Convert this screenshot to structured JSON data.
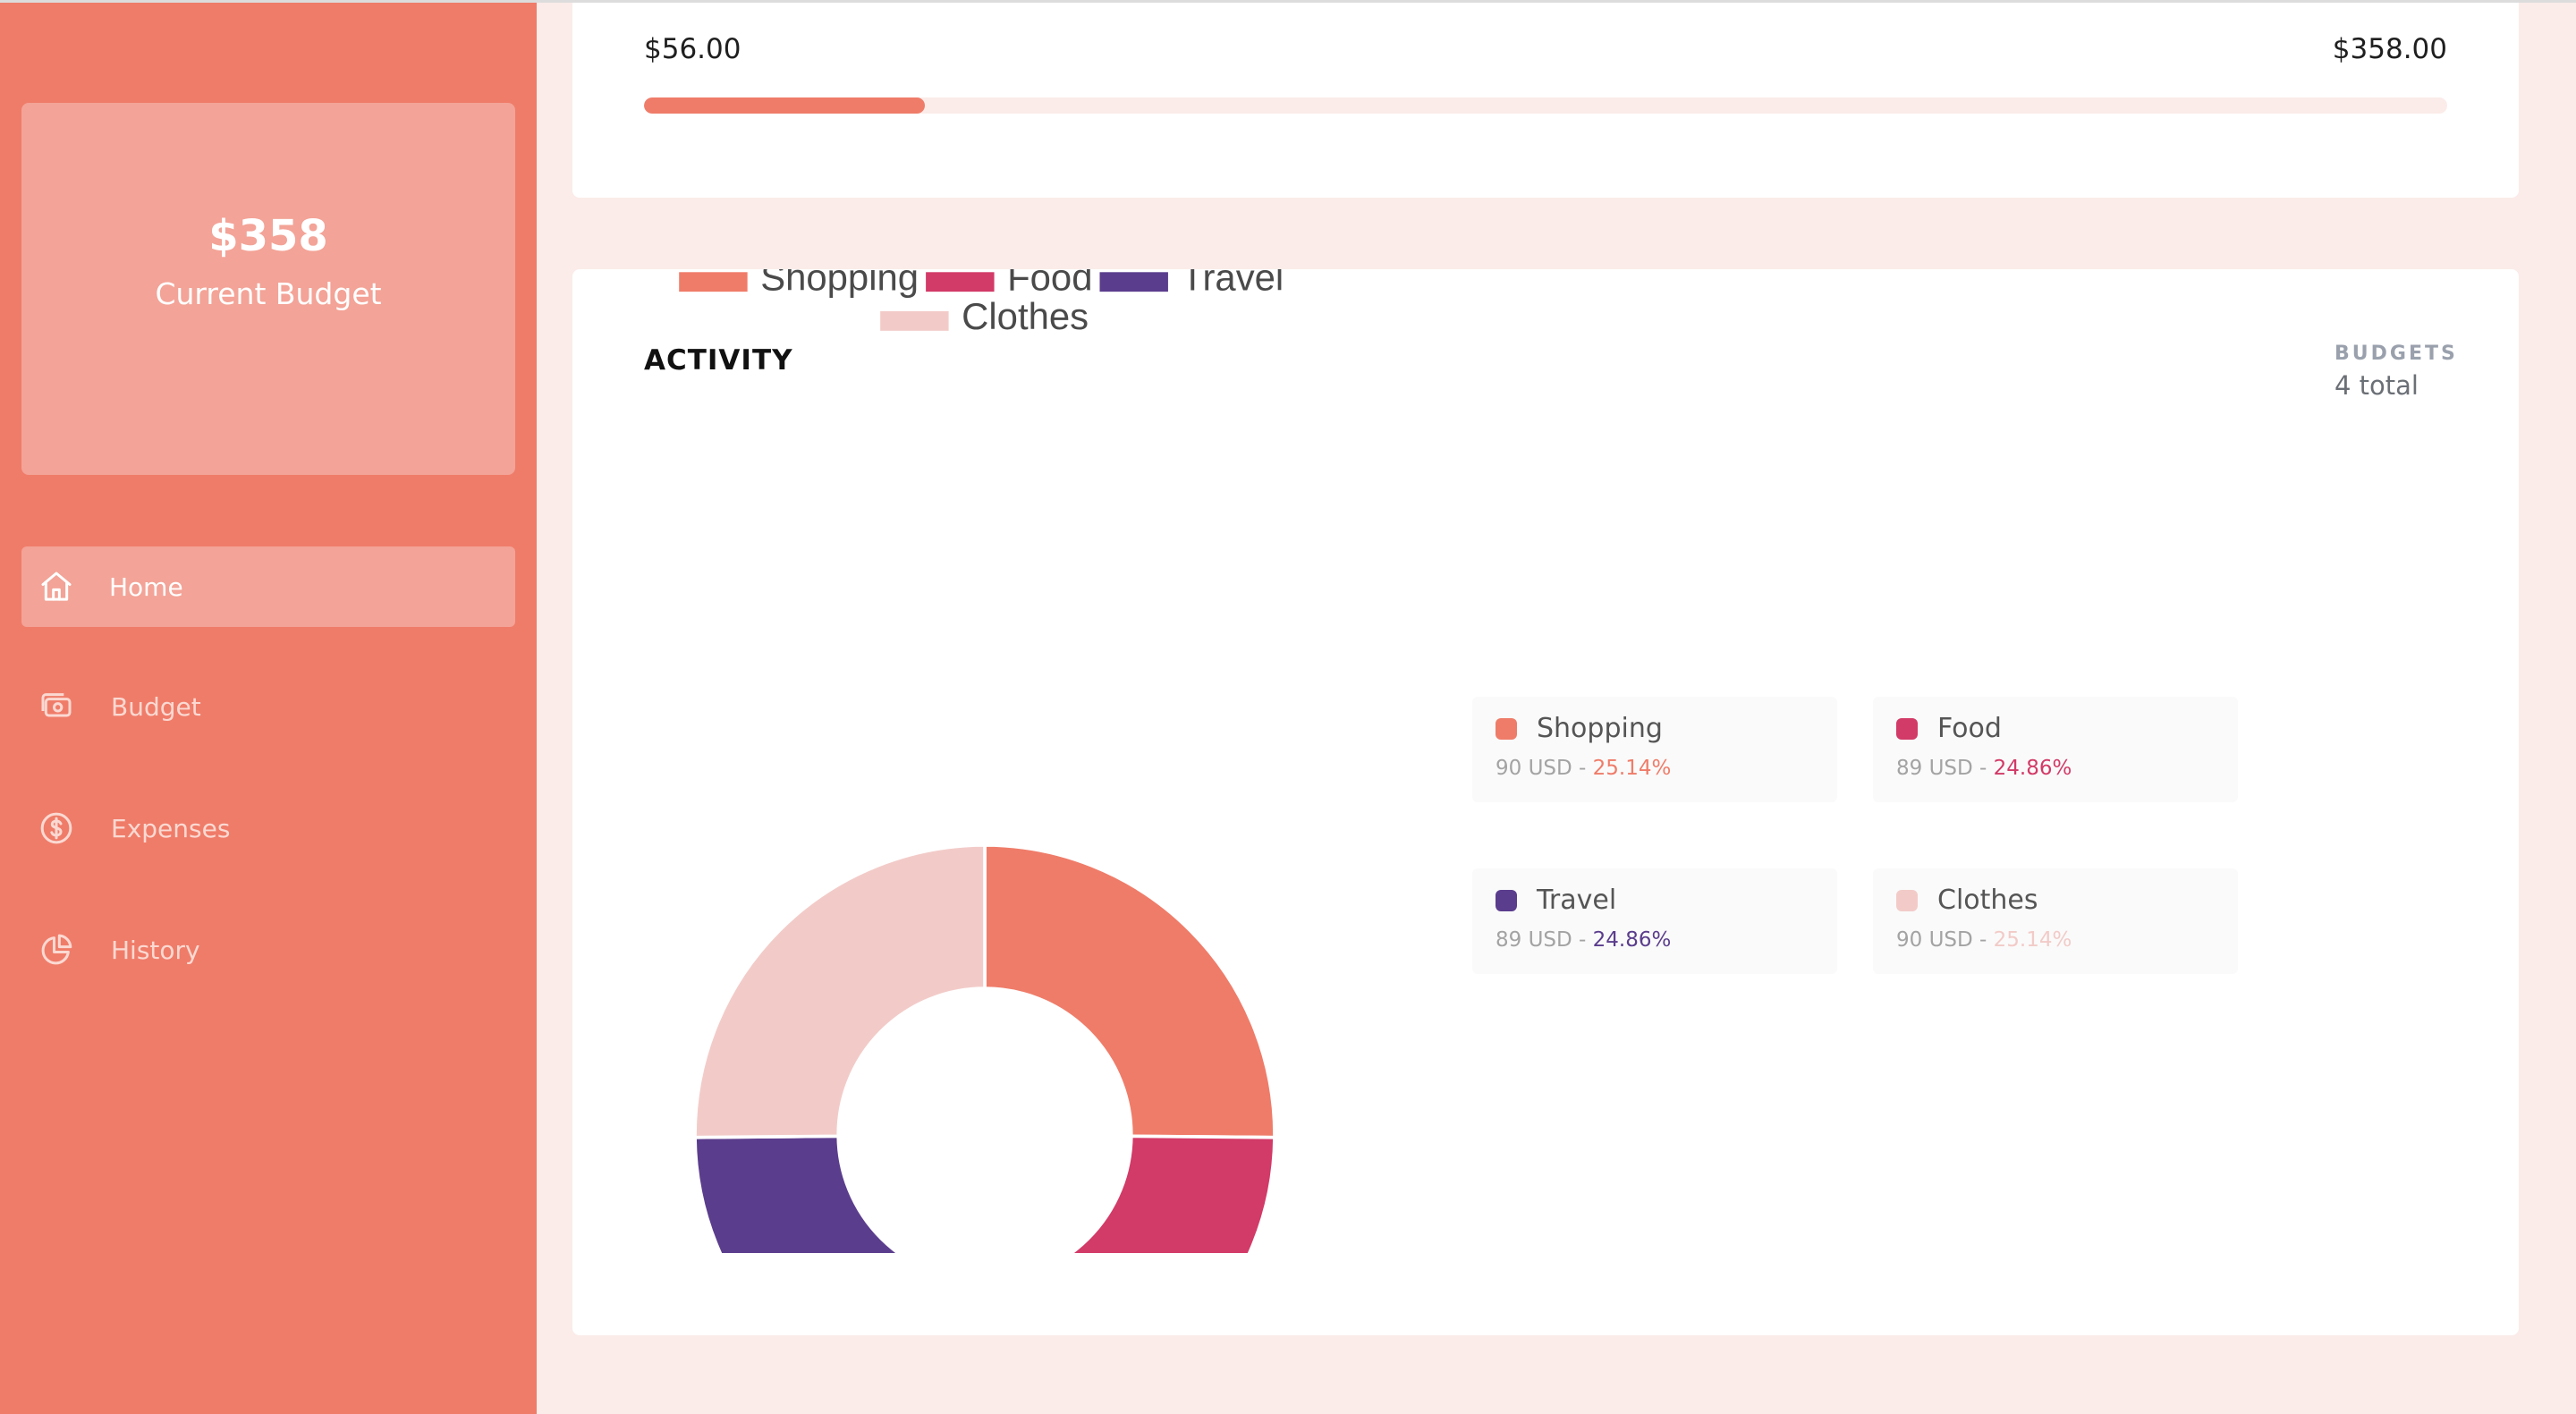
{
  "sidebar": {
    "budget_amount": "$358",
    "budget_label": "Current Budget",
    "items": [
      {
        "label": "Home",
        "icon": "home-icon",
        "active": true
      },
      {
        "label": "Budget",
        "icon": "money-icon",
        "active": false
      },
      {
        "label": "Expenses",
        "icon": "dollar-circle-icon",
        "active": false
      },
      {
        "label": "History",
        "icon": "pie-chart-icon",
        "active": false
      }
    ]
  },
  "summary": {
    "spent": "$56.00",
    "total": "$358.00",
    "progress_fraction": 0.156
  },
  "activity": {
    "title": "ACTIVITY",
    "budgets_label": "BUDGETS",
    "budgets_count": "4 total",
    "cards": [
      {
        "name": "Shopping",
        "usd": "90 USD - ",
        "percent": "25.14%",
        "color": "#ef7c69"
      },
      {
        "name": "Food",
        "usd": "89 USD - ",
        "percent": "24.86%",
        "color": "#d23a67"
      },
      {
        "name": "Travel",
        "usd": "89 USD - ",
        "percent": "24.86%",
        "color": "#5b3d8d"
      },
      {
        "name": "Clothes",
        "usd": "90 USD - ",
        "percent": "25.14%",
        "color": "#f2cbc8"
      }
    ]
  },
  "colors": {
    "accent": "#ef7c69",
    "sidebar_card": "#f3a397",
    "background": "#fbece9"
  },
  "chart_data": {
    "type": "pie",
    "donut": true,
    "categories": [
      "Shopping",
      "Food",
      "Travel",
      "Clothes"
    ],
    "values": [
      90,
      89,
      89,
      90
    ],
    "colors": [
      "#ef7c69",
      "#d23a67",
      "#5b3d8d",
      "#f2cbc8"
    ],
    "legend_position": "top"
  }
}
